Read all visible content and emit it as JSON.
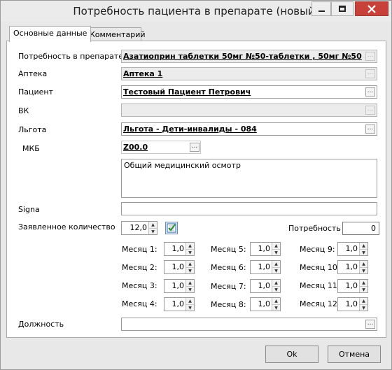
{
  "window": {
    "title": "Потребность пациента в препарате (новый)"
  },
  "tabs": [
    "Основные данные",
    "Комментарий"
  ],
  "form": {
    "need_label": "Потребность в препарате",
    "need_value": "Азатиоприн таблетки  50мг №50-таблетки , 50мг №50",
    "pharmacy_label": "Аптека",
    "pharmacy_value": "Аптека 1",
    "patient_label": "Пациент",
    "patient_value": "Тестовый Пациент Петрович",
    "vk_label": "ВК",
    "vk_value": "",
    "benefit_label": "Льгота",
    "benefit_value": "Льгота - Дети-инвалиды - 084",
    "mkb_label": "МКБ",
    "mkb_value": "Z00.0",
    "mkb_description": "Общий медицинский осмотр",
    "signa_label": "Signa",
    "signa_value": "",
    "declared_label": "Заявленное количество",
    "declared_value": "12,0",
    "need_qty_label": "Потребность",
    "need_qty_value": "0",
    "position_label": "Должность",
    "position_value": "",
    "ellipsis": "..."
  },
  "months": [
    {
      "label": "Месяц 1:",
      "value": "1,0"
    },
    {
      "label": "Месяц 2:",
      "value": "1,0"
    },
    {
      "label": "Месяц 3:",
      "value": "1,0"
    },
    {
      "label": "Месяц 4:",
      "value": "1,0"
    },
    {
      "label": "Месяц 5:",
      "value": "1,0"
    },
    {
      "label": "Месяц 6:",
      "value": "1,0"
    },
    {
      "label": "Месяц 7:",
      "value": "1,0"
    },
    {
      "label": "Месяц 8:",
      "value": "1,0"
    },
    {
      "label": "Месяц 9:",
      "value": "1,0"
    },
    {
      "label": "Месяц 10:",
      "value": "1,0"
    },
    {
      "label": "Месяц 11:",
      "value": "1,0"
    },
    {
      "label": "Месяц 12:",
      "value": "1,0"
    }
  ],
  "buttons": {
    "ok": "Ok",
    "cancel": "Отмена"
  },
  "icons": {
    "minimize": "minimize-icon",
    "maximize": "maximize-icon",
    "close": "close-icon",
    "calculate": "calculator-check-icon",
    "spin": "spin-arrows-icon"
  },
  "colors": {
    "close_button": "#c7413a",
    "window_bg": "#e8e8e8",
    "panel_bg": "#ffffff"
  }
}
